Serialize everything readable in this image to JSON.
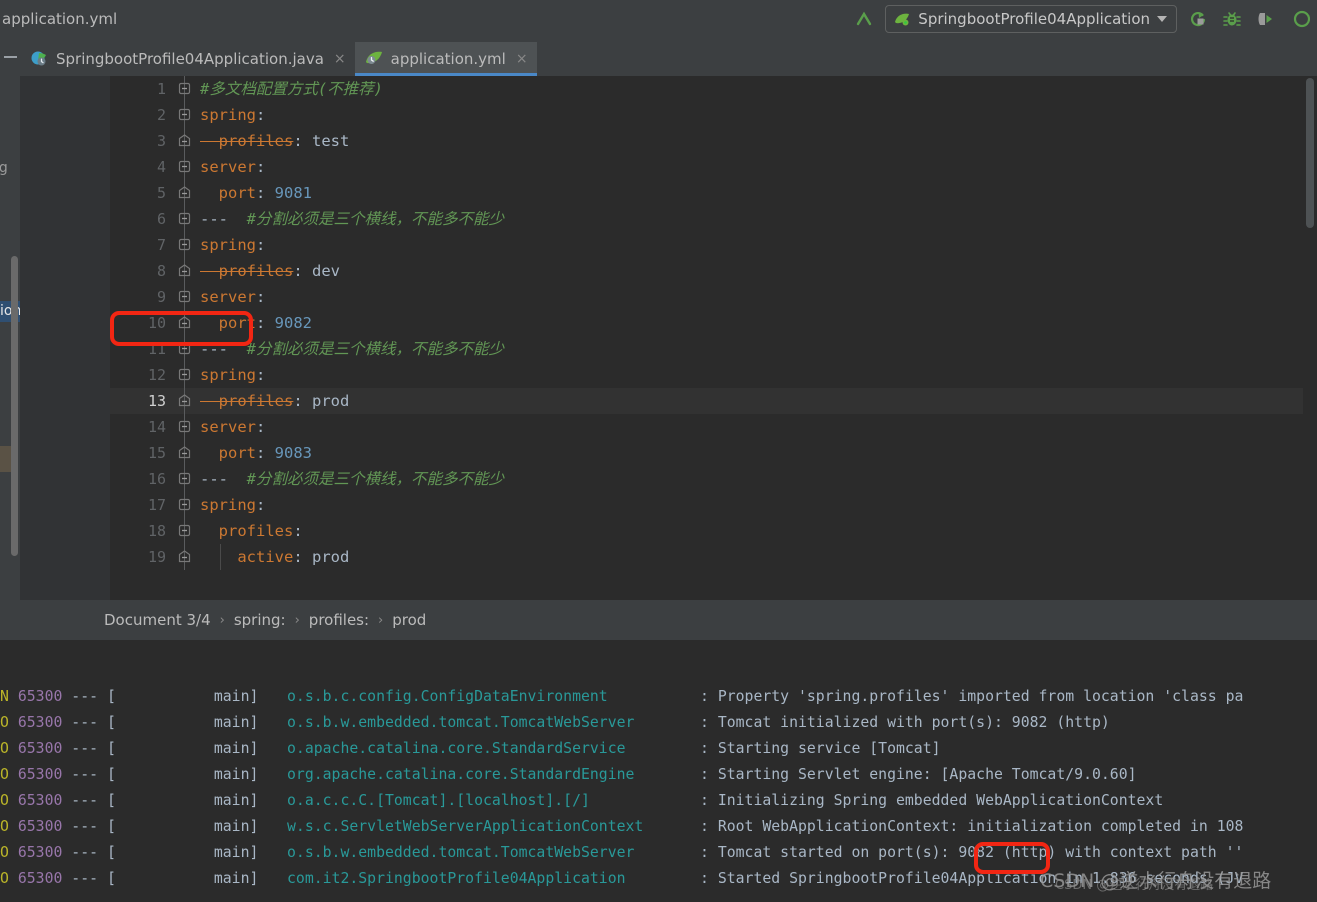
{
  "window": {
    "title": "application.yml"
  },
  "toolbar": {
    "run_config_label": "SpringbootProfile04Application",
    "icons": [
      {
        "name": "build-arrow-icon",
        "title": "Build"
      },
      {
        "name": "rerun-icon",
        "title": "Rerun"
      },
      {
        "name": "debug-bug-icon",
        "title": "Debug"
      },
      {
        "name": "run-with-coverage-icon",
        "title": "Run with Coverage"
      },
      {
        "name": "profiler-icon",
        "title": "Profiler"
      }
    ]
  },
  "tabs": [
    {
      "label": "SpringbootProfile04Application.java",
      "icon": "spring-java-icon",
      "active": false,
      "close": "×"
    },
    {
      "label": "application.yml",
      "icon": "spring-yml-leaf-icon",
      "active": true,
      "close": "×"
    }
  ],
  "left_strip": {
    "fragments": [
      {
        "text": "ng",
        "selected": false
      },
      {
        "text": "ion",
        "selected": true
      }
    ]
  },
  "editor": {
    "current_line": 13,
    "lines": [
      {
        "no": 1,
        "fold": "open",
        "indent": 0,
        "tokens": [
          {
            "t": "comment",
            "v": "#多文档配置方式(不推荐)"
          }
        ]
      },
      {
        "no": 2,
        "fold": "open",
        "indent": 0,
        "tokens": [
          {
            "t": "key",
            "v": "spring"
          },
          {
            "t": "colon",
            "v": ":"
          }
        ]
      },
      {
        "no": 3,
        "fold": "end",
        "indent": 1,
        "tokens": [
          {
            "t": "key-dep",
            "v": "  profiles"
          },
          {
            "t": "colon",
            "v": ":"
          },
          {
            "t": "val",
            "v": " test"
          }
        ]
      },
      {
        "no": 4,
        "fold": "open",
        "indent": 0,
        "tokens": [
          {
            "t": "key",
            "v": "server"
          },
          {
            "t": "colon",
            "v": ":"
          }
        ]
      },
      {
        "no": 5,
        "fold": "end",
        "indent": 1,
        "tokens": [
          {
            "t": "key",
            "v": "  port"
          },
          {
            "t": "colon",
            "v": ":"
          },
          {
            "t": "num",
            "v": " 9081"
          }
        ]
      },
      {
        "no": 6,
        "fold": "open",
        "indent": 0,
        "tokens": [
          {
            "t": "dash",
            "v": "---"
          },
          {
            "t": "comment",
            "v": "  #分割必须是三个横线，不能多不能少"
          }
        ]
      },
      {
        "no": 7,
        "fold": "open",
        "indent": 0,
        "tokens": [
          {
            "t": "key",
            "v": "spring"
          },
          {
            "t": "colon",
            "v": ":"
          }
        ]
      },
      {
        "no": 8,
        "fold": "end",
        "indent": 1,
        "tokens": [
          {
            "t": "key-dep",
            "v": "  profiles"
          },
          {
            "t": "colon",
            "v": ":"
          },
          {
            "t": "val",
            "v": " dev"
          }
        ]
      },
      {
        "no": 9,
        "fold": "open",
        "indent": 0,
        "tokens": [
          {
            "t": "key",
            "v": "server"
          },
          {
            "t": "colon",
            "v": ":"
          }
        ]
      },
      {
        "no": 10,
        "fold": "end",
        "indent": 1,
        "tokens": [
          {
            "t": "key",
            "v": "  port"
          },
          {
            "t": "colon",
            "v": ":"
          },
          {
            "t": "num",
            "v": " 9082"
          }
        ]
      },
      {
        "no": 11,
        "fold": "open",
        "indent": 0,
        "tokens": [
          {
            "t": "dash",
            "v": "---"
          },
          {
            "t": "comment",
            "v": "  #分割必须是三个横线，不能多不能少"
          }
        ]
      },
      {
        "no": 12,
        "fold": "open",
        "indent": 0,
        "tokens": [
          {
            "t": "key",
            "v": "spring"
          },
          {
            "t": "colon",
            "v": ":"
          }
        ]
      },
      {
        "no": 13,
        "fold": "end",
        "indent": 1,
        "tokens": [
          {
            "t": "key-dep",
            "v": "  profiles"
          },
          {
            "t": "colon",
            "v": ":"
          },
          {
            "t": "val",
            "v": " prod"
          }
        ]
      },
      {
        "no": 14,
        "fold": "open",
        "indent": 0,
        "tokens": [
          {
            "t": "key",
            "v": "server"
          },
          {
            "t": "colon",
            "v": ":"
          }
        ]
      },
      {
        "no": 15,
        "fold": "end",
        "indent": 1,
        "tokens": [
          {
            "t": "key",
            "v": "  port"
          },
          {
            "t": "colon",
            "v": ":"
          },
          {
            "t": "num",
            "v": " 9083"
          }
        ]
      },
      {
        "no": 16,
        "fold": "open",
        "indent": 0,
        "tokens": [
          {
            "t": "dash",
            "v": "---"
          },
          {
            "t": "comment",
            "v": "  #分割必须是三个横线，不能多不能少"
          }
        ]
      },
      {
        "no": 17,
        "fold": "open",
        "indent": 0,
        "tokens": [
          {
            "t": "key",
            "v": "spring"
          },
          {
            "t": "colon",
            "v": ":"
          }
        ]
      },
      {
        "no": 18,
        "fold": "open",
        "indent": 1,
        "tokens": [
          {
            "t": "key",
            "v": "  profiles"
          },
          {
            "t": "colon",
            "v": ":"
          }
        ]
      },
      {
        "no": 19,
        "fold": "end",
        "indent": 2,
        "tokens": [
          {
            "t": "key",
            "v": "    active"
          },
          {
            "t": "colon",
            "v": ":"
          },
          {
            "t": "val",
            "v": " prod"
          }
        ]
      }
    ]
  },
  "annotations": {
    "editor_highlight": {
      "label": "port: 9082",
      "color": "#f22613"
    },
    "console_highlight": {
      "label": "9082",
      "color": "#f22613"
    }
  },
  "breadcrumb": {
    "items": [
      "Document 3/4",
      "spring:",
      "profiles:",
      "prod"
    ],
    "separator": "›"
  },
  "console": {
    "lines": [
      {
        "level_frag": "N",
        "pid": "65300",
        "dashes": "---",
        "thread": "[           main]",
        "logger": "o.s.b.c.config.ConfigDataEnvironment",
        "message": ": Property 'spring.profiles' imported from location 'class pa"
      },
      {
        "level_frag": "O",
        "pid": "65300",
        "dashes": "---",
        "thread": "[           main]",
        "logger": "o.s.b.w.embedded.tomcat.TomcatWebServer",
        "message": ": Tomcat initialized with port(s): 9082 (http)"
      },
      {
        "level_frag": "O",
        "pid": "65300",
        "dashes": "---",
        "thread": "[           main]",
        "logger": "o.apache.catalina.core.StandardService",
        "message": ": Starting service [Tomcat]"
      },
      {
        "level_frag": "O",
        "pid": "65300",
        "dashes": "---",
        "thread": "[           main]",
        "logger": "org.apache.catalina.core.StandardEngine",
        "message": ": Starting Servlet engine: [Apache Tomcat/9.0.60]"
      },
      {
        "level_frag": "O",
        "pid": "65300",
        "dashes": "---",
        "thread": "[           main]",
        "logger": "o.a.c.c.C.[Tomcat].[localhost].[/]",
        "message": ": Initializing Spring embedded WebApplicationContext"
      },
      {
        "level_frag": "O",
        "pid": "65300",
        "dashes": "---",
        "thread": "[           main]",
        "logger": "w.s.c.ServletWebServerApplicationContext",
        "message": ": Root WebApplicationContext: initialization completed in 108"
      },
      {
        "level_frag": "O",
        "pid": "65300",
        "dashes": "---",
        "thread": "[           main]",
        "logger": "o.s.b.w.embedded.tomcat.TomcatWebServer",
        "message": ": Tomcat started on port(s): 9082 (http) with context path ''"
      },
      {
        "level_frag": "O",
        "pid": "65300",
        "dashes": "---",
        "thread": "[           main]",
        "logger": "com.it2.SpringbootProfile04Application",
        "message": ": Started SpringbootProfile04Application in 1.836 seconds (JV"
      }
    ]
  },
  "watermark": {
    "text": "CSDN @逆水行舟没有退路",
    "text2": "CSDN @逆水行舟没有退路"
  }
}
